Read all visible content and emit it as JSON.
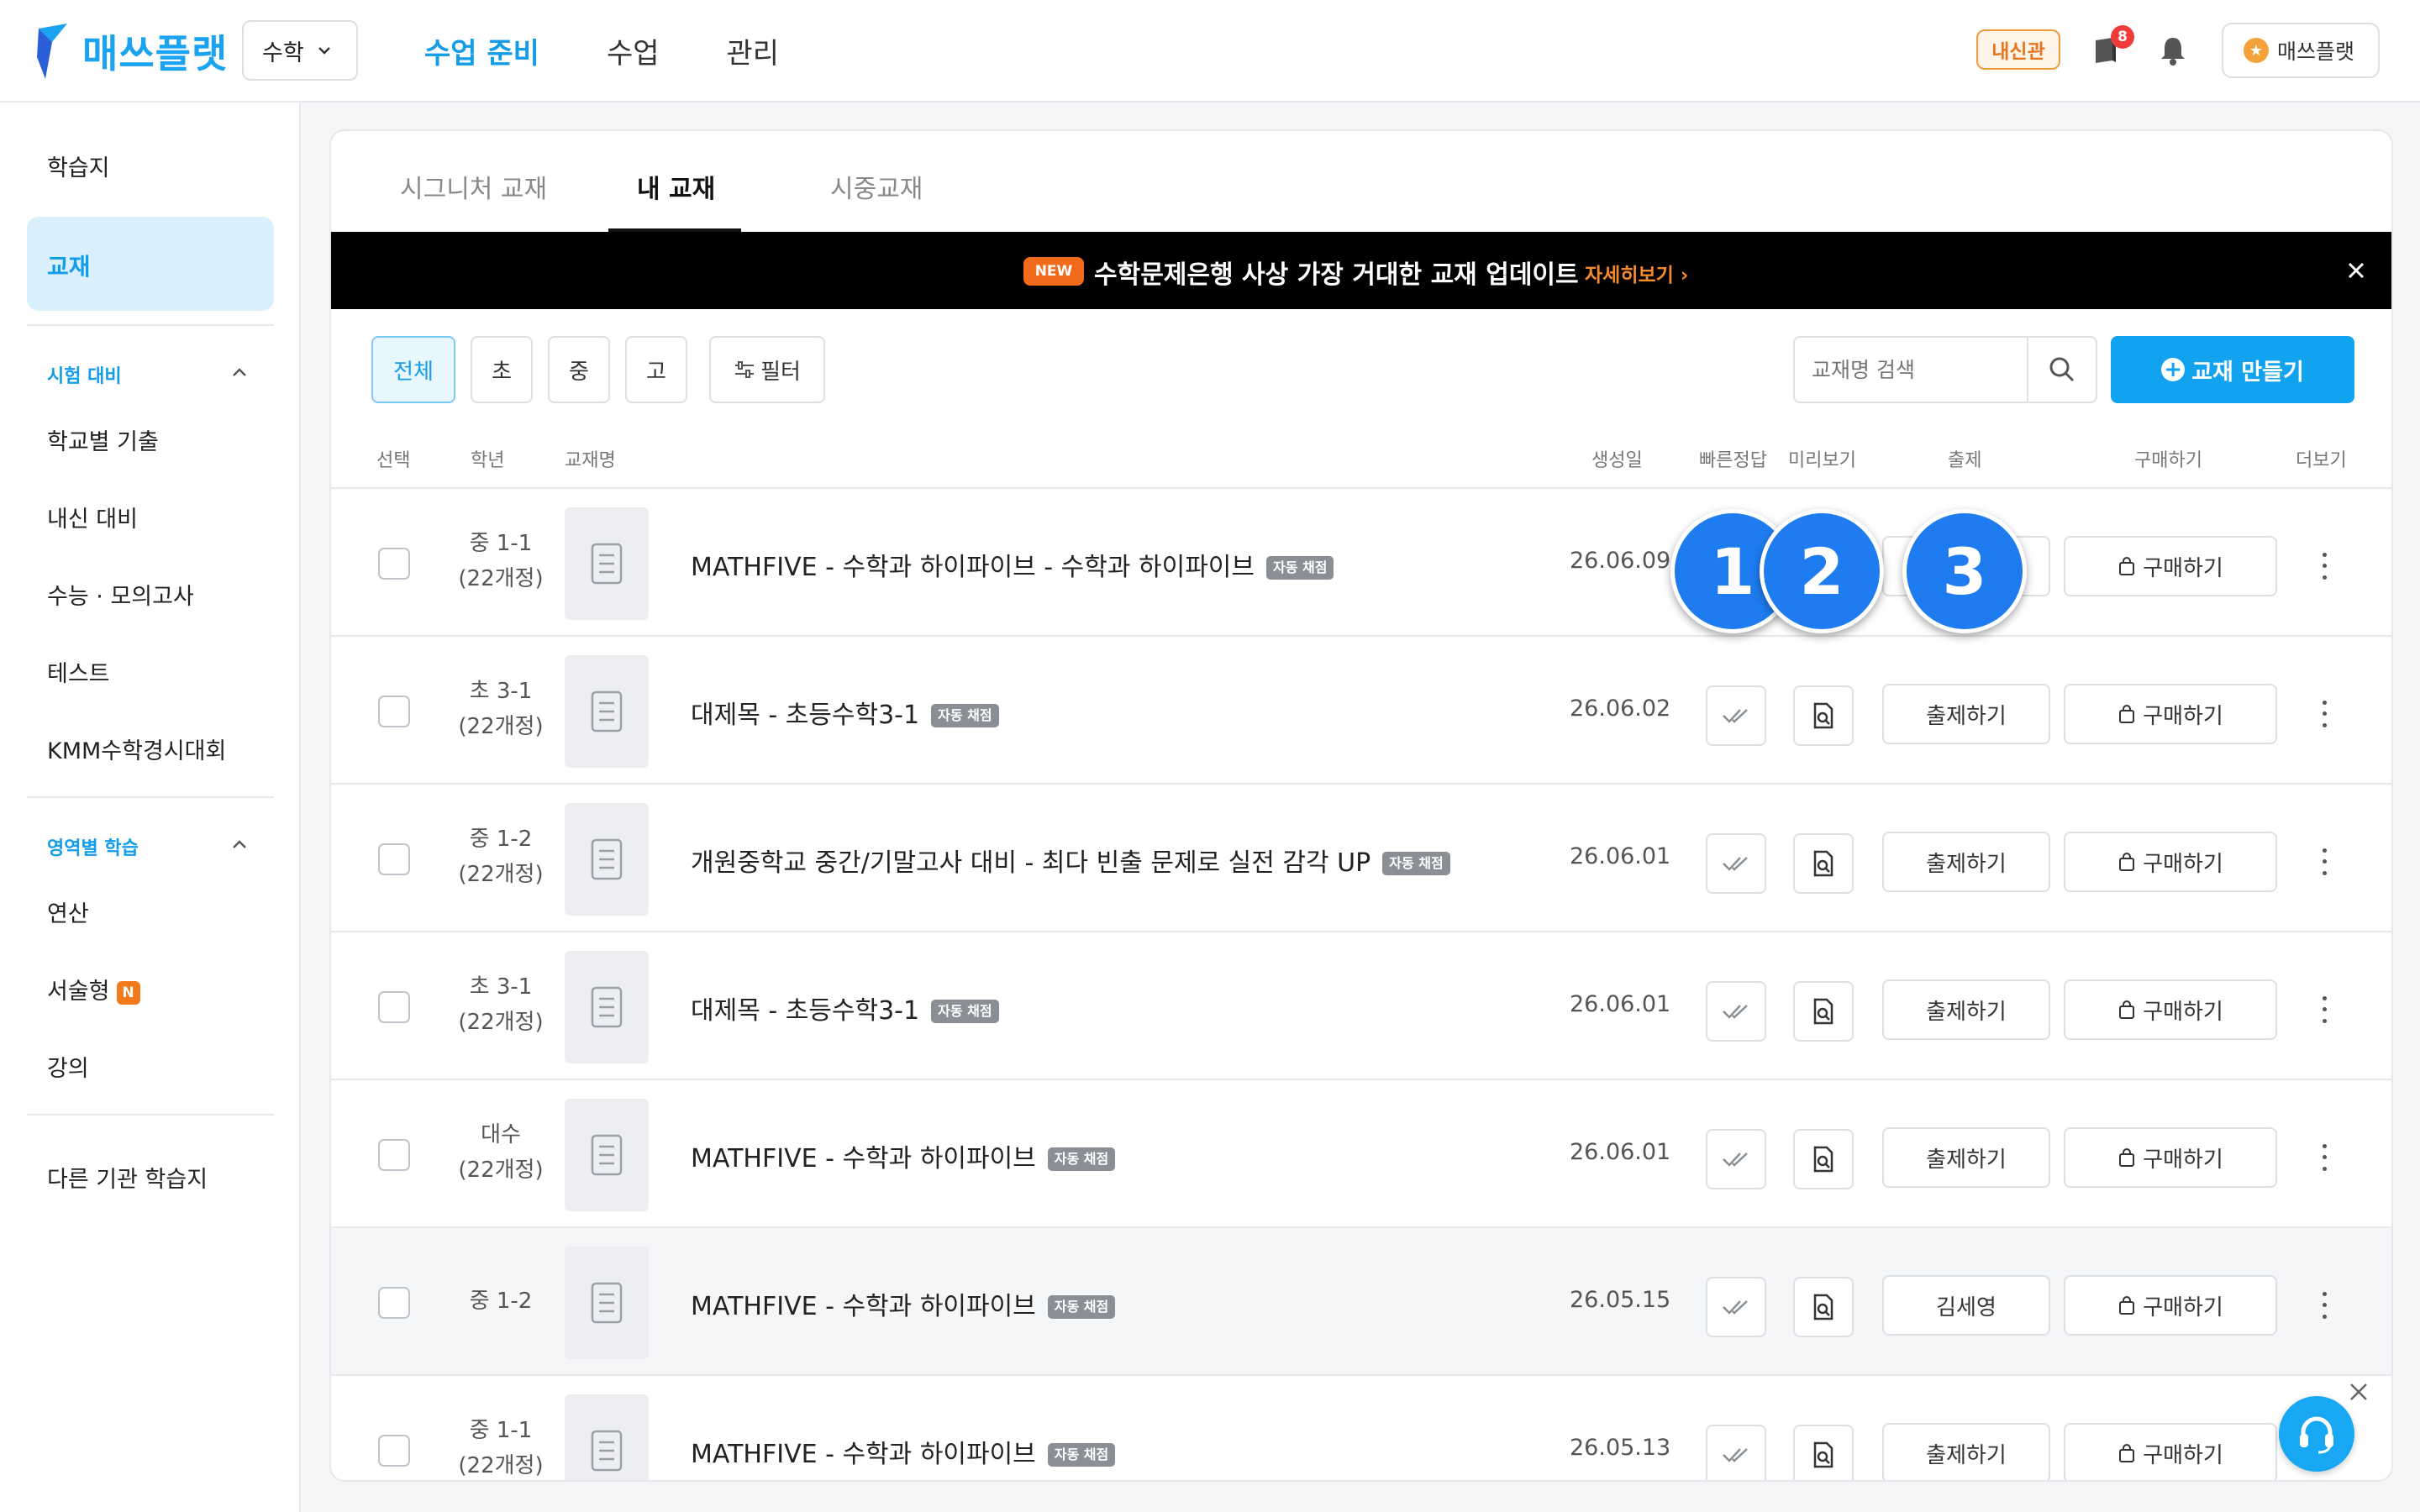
{
  "header": {
    "logo_text": "매쓰플랫",
    "subject": "수학",
    "nav": [
      "수업 준비",
      "수업",
      "관리"
    ],
    "badge": "내신관",
    "notification_count": "8",
    "profile_label": "매쓰플랫",
    "brand_color": "#1aa3f0"
  },
  "sidebar": {
    "top_item": "학습지",
    "active_item": "교재",
    "section1": {
      "title": "시험 대비",
      "items": [
        "학교별 기출",
        "내신 대비",
        "수능 · 모의고사",
        "테스트",
        "KMM수학경시대회"
      ]
    },
    "section2": {
      "title": "영역별 학습",
      "items": [
        "연산",
        "서술형",
        "강의"
      ],
      "new_badge": "N"
    },
    "bottom_item": "다른 기관 학습지"
  },
  "tabs": [
    "시그니처 교재",
    "내 교재",
    "시중교재"
  ],
  "banner": {
    "new_label": "NEW",
    "text": "수학문제은행 사상 가장 거대한 교재 업데이트",
    "link": "자세히보기"
  },
  "filters": {
    "chips": [
      "전체",
      "초",
      "중",
      "고"
    ],
    "filter_label": "필터",
    "search_placeholder": "교재명 검색",
    "create_label": "교재 만들기"
  },
  "columns": [
    "선택",
    "학년",
    "교재명",
    "생성일",
    "빠른정답",
    "미리보기",
    "출제",
    "구매하기",
    "더보기"
  ],
  "auto_tag": "자동 채점",
  "buy_label": "구매하기",
  "rows": [
    {
      "grade1": "중 1-1",
      "grade2": "(22개정)",
      "title": "MATHFIVE - 수학과 하이파이브 - 수학과 하이파이브",
      "date": "26.06.09",
      "action": ""
    },
    {
      "grade1": "초 3-1",
      "grade2": "(22개정)",
      "title": "대제목 - 초등수학3-1",
      "date": "26.06.02",
      "action": "출제하기"
    },
    {
      "grade1": "중 1-2",
      "grade2": "(22개정)",
      "title": "개원중학교 중간/기말고사 대비 - 최다 빈출 문제로 실전 감각 UP",
      "date": "26.06.01",
      "action": "출제하기"
    },
    {
      "grade1": "초 3-1",
      "grade2": "(22개정)",
      "title": "대제목 - 초등수학3-1",
      "date": "26.06.01",
      "action": "출제하기"
    },
    {
      "grade1": "대수",
      "grade2": "(22개정)",
      "title": "MATHFIVE - 수학과 하이파이브",
      "date": "26.06.01",
      "action": "출제하기"
    },
    {
      "grade1": "중 1-2",
      "grade2": "",
      "title": "MATHFIVE - 수학과 하이파이브",
      "date": "26.05.15",
      "action": "김세영"
    },
    {
      "grade1": "중 1-1",
      "grade2": "(22개정)",
      "title": "MATHFIVE - 수학과 하이파이브",
      "date": "26.05.13",
      "action": "출제하기"
    }
  ],
  "callouts": [
    "1",
    "2",
    "3"
  ]
}
